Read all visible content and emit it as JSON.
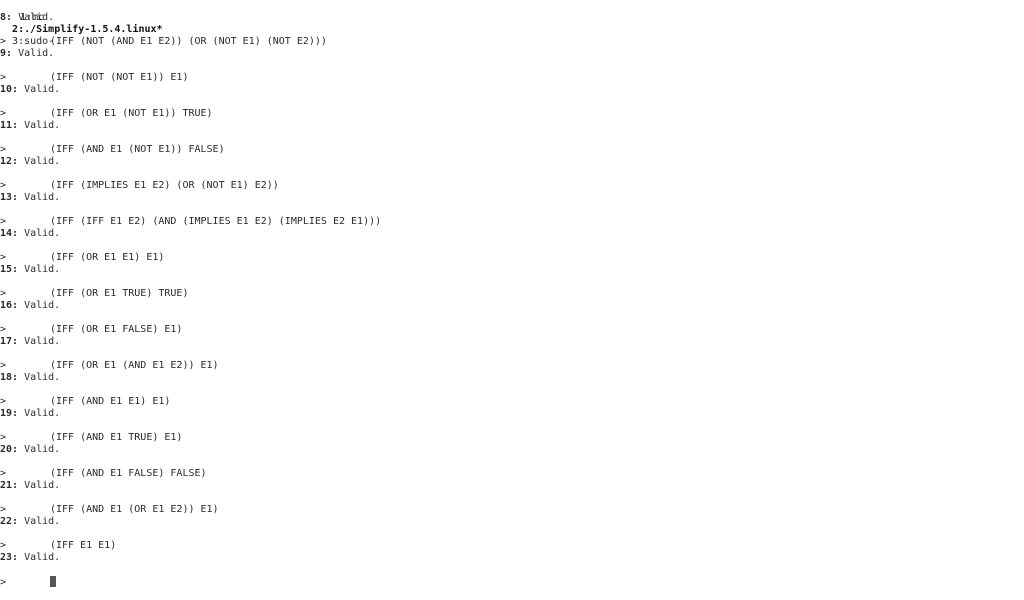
{
  "tabs": [
    {
      "label": "1:mc",
      "active": false
    },
    {
      "label": "2:./Simplify-1.5.4.linux*",
      "active": true
    },
    {
      "label": "3:sudo-",
      "active": false
    }
  ],
  "first_result": {
    "num": "8:",
    "text": " Valid."
  },
  "prompt_symbol": ">",
  "entries": [
    {
      "expr": "(IFF (NOT (AND E1 E2)) (OR (NOT E1) (NOT E2)))",
      "num": "9:",
      "result": " Valid."
    },
    {
      "expr": "(IFF (NOT (NOT E1)) E1)",
      "num": "10:",
      "result": " Valid."
    },
    {
      "expr": "(IFF (OR E1 (NOT E1)) TRUE)",
      "num": "11:",
      "result": " Valid."
    },
    {
      "expr": "(IFF (AND E1 (NOT E1)) FALSE)",
      "num": "12:",
      "result": " Valid."
    },
    {
      "expr": "(IFF (IMPLIES E1 E2) (OR (NOT E1) E2))",
      "num": "13:",
      "result": " Valid."
    },
    {
      "expr": "(IFF (IFF E1 E2) (AND (IMPLIES E1 E2) (IMPLIES E2 E1)))",
      "num": "14:",
      "result": " Valid."
    },
    {
      "expr": "(IFF (OR E1 E1) E1)",
      "num": "15:",
      "result": " Valid."
    },
    {
      "expr": "(IFF (OR E1 TRUE) TRUE)",
      "num": "16:",
      "result": " Valid."
    },
    {
      "expr": "(IFF (OR E1 FALSE) E1)",
      "num": "17:",
      "result": " Valid."
    },
    {
      "expr": "(IFF (OR E1 (AND E1 E2)) E1)",
      "num": "18:",
      "result": " Valid."
    },
    {
      "expr": "(IFF (AND E1 E1) E1)",
      "num": "19:",
      "result": " Valid."
    },
    {
      "expr": "(IFF (AND E1 TRUE) E1)",
      "num": "20:",
      "result": " Valid."
    },
    {
      "expr": "(IFF (AND E1 FALSE) FALSE)",
      "num": "21:",
      "result": " Valid."
    },
    {
      "expr": "(IFF (AND E1 (OR E1 E2)) E1)",
      "num": "22:",
      "result": " Valid."
    },
    {
      "expr": "(IFF E1 E1)",
      "num": "23:",
      "result": " Valid."
    }
  ]
}
